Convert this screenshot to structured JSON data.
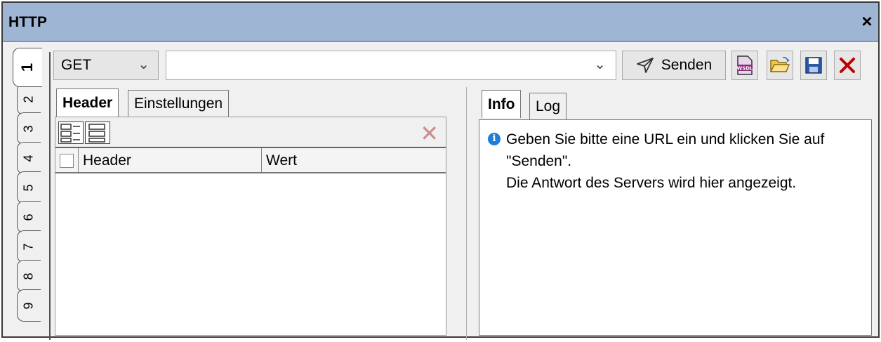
{
  "window": {
    "title": "HTTP",
    "close_glyph": "×"
  },
  "vertical_tabs": [
    "1",
    "2",
    "3",
    "4",
    "5",
    "6",
    "7",
    "8",
    "9"
  ],
  "active_vertical_tab": "1",
  "request": {
    "method": "GET",
    "url_value": "",
    "send_label": "Senden"
  },
  "toolbar_icons": [
    "wsdl-icon",
    "open-folder-icon",
    "save-icon",
    "close-icon"
  ],
  "left_tabs": {
    "header": "Header",
    "settings": "Einstellungen"
  },
  "header_table": {
    "col_header": "Header",
    "col_value": "Wert",
    "rows": []
  },
  "right_tabs": {
    "info": "Info",
    "log": "Log"
  },
  "info": {
    "icon": "i",
    "message": "Geben Sie bitte eine URL ein und klicken Sie auf\n\"Senden\".\nDie Antwort des Servers wird hier angezeigt."
  },
  "colors": {
    "titlebar": "#9eb6d4",
    "accent_red": "#c00000",
    "info_blue": "#1f7fd8"
  }
}
